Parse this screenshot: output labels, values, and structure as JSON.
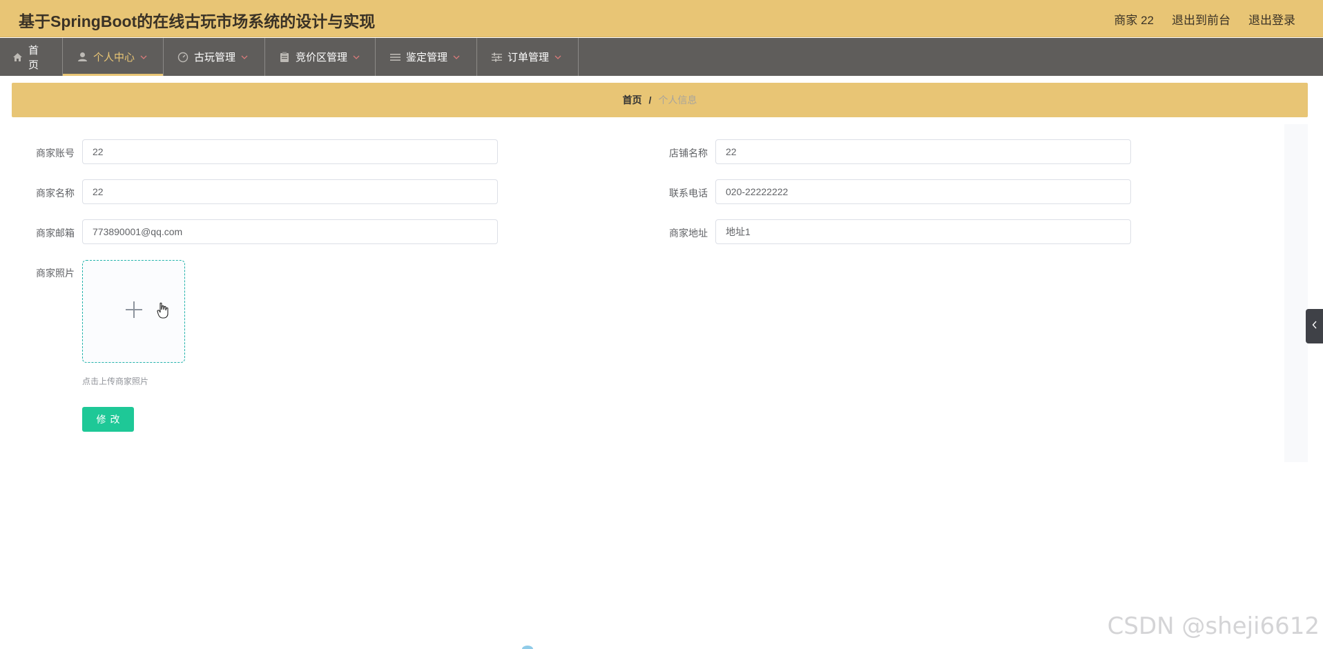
{
  "header": {
    "title": "基于SpringBoot的在线古玩市场系统的设计与实现",
    "user_label": "商家 22",
    "to_front_label": "退出到前台",
    "logout_label": "退出登录"
  },
  "nav": {
    "items": [
      {
        "label": "首页",
        "icon": "home-icon"
      },
      {
        "label": "个人中心",
        "icon": "user-icon"
      },
      {
        "label": "古玩管理",
        "icon": "gauge-icon"
      },
      {
        "label": "竞价区管理",
        "icon": "clipboard-icon"
      },
      {
        "label": "鉴定管理",
        "icon": "list-icon"
      },
      {
        "label": "订单管理",
        "icon": "sliders-icon"
      }
    ],
    "active_index": 1
  },
  "breadcrumb": {
    "home": "首页",
    "separator": "/",
    "current": "个人信息"
  },
  "form": {
    "account_label": "商家账号",
    "account_value": "22",
    "shop_name_label": "店铺名称",
    "shop_name_value": "22",
    "merchant_name_label": "商家名称",
    "merchant_name_value": "22",
    "phone_label": "联系电话",
    "phone_value": "020-22222222",
    "email_label": "商家邮箱",
    "email_value": "773890001@qq.com",
    "address_label": "商家地址",
    "address_value": "地址1",
    "photo_label": "商家照片",
    "upload_hint": "点击上传商家照片",
    "submit_label": "修改"
  },
  "watermark": "CSDN @sheji6612",
  "colors": {
    "header_bg": "#e8c575",
    "nav_bg": "#5f5d5b",
    "accent": "#e8c575",
    "button": "#1ec897",
    "upload_border": "#20b2aa"
  }
}
